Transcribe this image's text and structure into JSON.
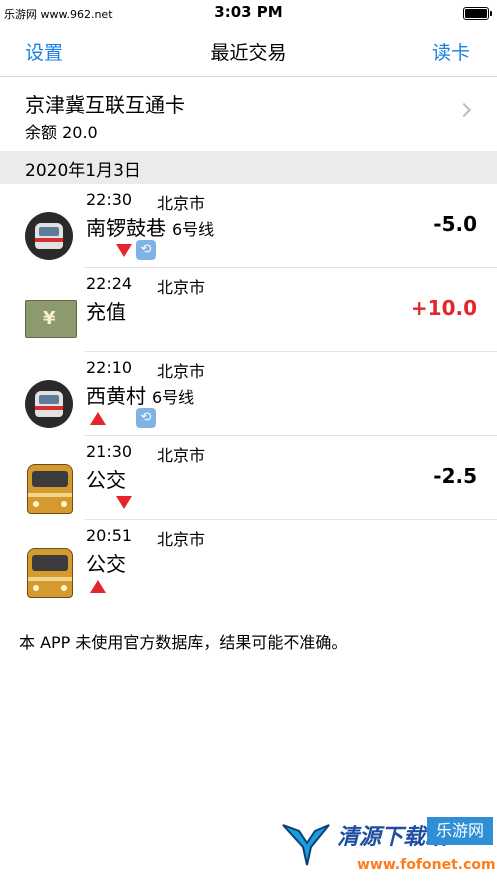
{
  "status_bar": {
    "carrier": "乐游网 www.962.net",
    "time": "3:03 PM"
  },
  "nav": {
    "left_button": "设置",
    "title": "最近交易",
    "right_button": "读卡"
  },
  "card": {
    "name": "京津冀互联互通卡",
    "balance": "余额 20.0"
  },
  "section_header": "2020年1月3日",
  "transactions": [
    {
      "time": "22:30",
      "city": "北京市",
      "place": "南锣鼓巷",
      "line": "6号线",
      "amount": "-5.0",
      "icon": "metro-icon"
    },
    {
      "time": "22:24",
      "city": "北京市",
      "place": "充值",
      "line": "",
      "amount": "+10.0",
      "icon": "money-icon"
    },
    {
      "time": "22:10",
      "city": "北京市",
      "place": "西黄村",
      "line": "6号线",
      "amount": "",
      "icon": "metro-icon"
    },
    {
      "time": "21:30",
      "city": "北京市",
      "place": "公交",
      "line": "",
      "amount": "-2.5",
      "icon": "bus-icon"
    },
    {
      "time": "20:51",
      "city": "北京市",
      "place": "公交",
      "line": "",
      "amount": "",
      "icon": "bus-icon"
    }
  ],
  "disclaimer": "本 APP 未使用官方数据库，结果可能不准确。",
  "watermark": {
    "name": "清源下载站",
    "badge": "乐游网",
    "url": "www.fofonet.com"
  },
  "colors": {
    "accent": "#1a7fe5",
    "positive_amount": "#e5242c",
    "section_bg": "#ebebeb"
  }
}
